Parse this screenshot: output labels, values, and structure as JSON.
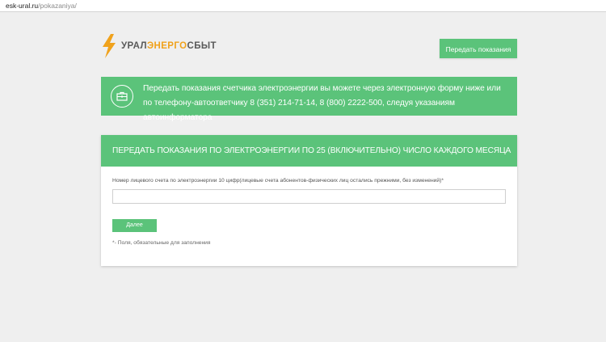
{
  "address_bar": {
    "domain": "esk-ural.ru",
    "path": "/pokazaniya/"
  },
  "logo": {
    "part1": "УРАЛ",
    "part2": "ЭНЕРГО",
    "part3": "СБЫТ",
    "icon": "lightning-bolt-icon",
    "colors": {
      "bolt": "#f0a21c",
      "text": "#5a5a5a"
    }
  },
  "header": {
    "submit_readings_button": "Передать показания"
  },
  "banner": {
    "icon": "briefcase-icon",
    "text": "Передать показания счетчика электроэнергии вы можете через электронную форму ниже или по телефону-автоответчику 8 (351) 214-71-14, 8 (800) 2222-500, следуя указаниям автоинформатора"
  },
  "form": {
    "title": "ПЕРЕДАТЬ ПОКАЗАНИЯ ПО ЭЛЕКТРОЭНЕРГИИ ПО 25 (ВКЛЮЧИТЕЛЬНО) ЧИСЛО КАЖДОГО МЕСЯЦА",
    "account_field_label": "Номер лицевого счета по электроэнергии 10 цифр(лицевые счета абонентов-физических лиц остались прежними, без изменений)*",
    "account_field_value": "",
    "next_button": "Далее",
    "required_note": "*- Поля, обязательные для заполнения"
  },
  "theme": {
    "accent": "#5bc37a",
    "background": "#efefef"
  }
}
